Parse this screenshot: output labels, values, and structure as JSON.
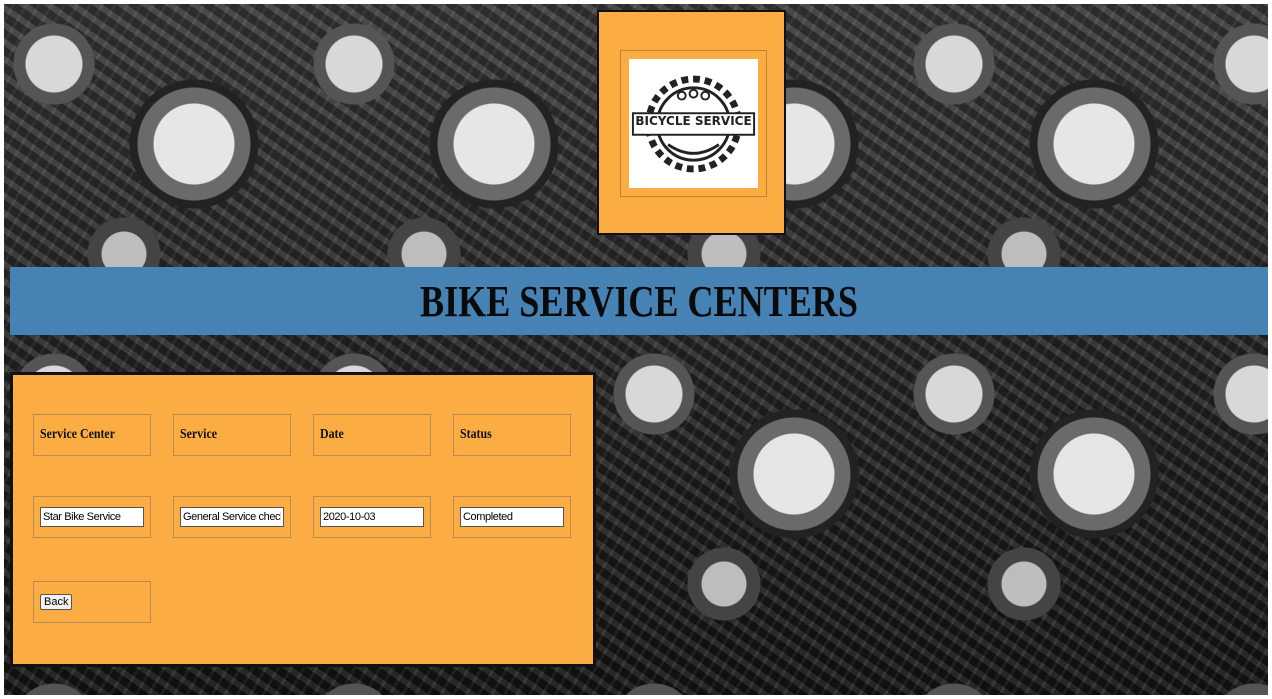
{
  "logo": {
    "text": "BICYCLE SERVICE"
  },
  "banner": {
    "title": "BIKE SERVICE CENTERS"
  },
  "table": {
    "headers": [
      "Service Center",
      "Service",
      "Date",
      "Status"
    ],
    "row": {
      "service_center": "Star Bike Service",
      "service": "General Service check-up",
      "date": "2020-10-03",
      "status": "Completed"
    }
  },
  "actions": {
    "back_label": "Back"
  },
  "colors": {
    "panel": "#fbad43",
    "banner": "#4682b4"
  }
}
